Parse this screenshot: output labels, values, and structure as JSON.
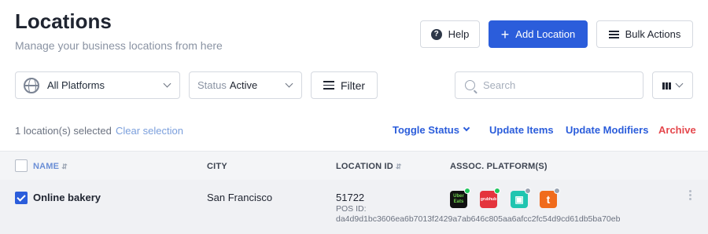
{
  "header": {
    "title": "Locations",
    "subtitle": "Manage your business locations from here",
    "help_label": "Help",
    "add_label": "Add Location",
    "bulk_label": "Bulk Actions"
  },
  "filters": {
    "platform_value": "All Platforms",
    "status_label": "Status",
    "status_value": "Active",
    "filter_label": "Filter",
    "search_placeholder": "Search"
  },
  "selection": {
    "count_text": "1 location(s) selected",
    "clear_label": "Clear selection",
    "actions": {
      "toggle_status": "Toggle Status",
      "update_items": "Update Items",
      "update_modifiers": "Update Modifiers",
      "archive": "Archive"
    }
  },
  "table": {
    "columns": {
      "name": "NAME",
      "city": "CITY",
      "location_id": "LOCATION ID",
      "platforms": "ASSOC. PLATFORM(S)"
    },
    "rows": [
      {
        "selected": true,
        "name": "Online bakery",
        "city": "San Francisco",
        "location_id": "51722",
        "pos_label": "POS ID:",
        "pos_id": "da4d9d1bc3606ea6b7013f2429a7ab646c805aa6afcc2fc54d9cd61db5ba70eb",
        "platforms": [
          {
            "name": "uber-eats",
            "text": "Uber Eats",
            "status_color": "#22c55e"
          },
          {
            "name": "grubhub",
            "text": "grubhub",
            "status_color": "#22c55e"
          },
          {
            "name": "deliveroo",
            "text": "",
            "status_color": "#9aa3b2"
          },
          {
            "name": "thuisbezorgd",
            "text": "t",
            "status_color": "#9aa3b2"
          }
        ]
      }
    ]
  },
  "colors": {
    "primary": "#2b5ddb",
    "danger": "#e5484d",
    "online_dot": "#22c55e",
    "offline_dot": "#9aa3b2"
  }
}
